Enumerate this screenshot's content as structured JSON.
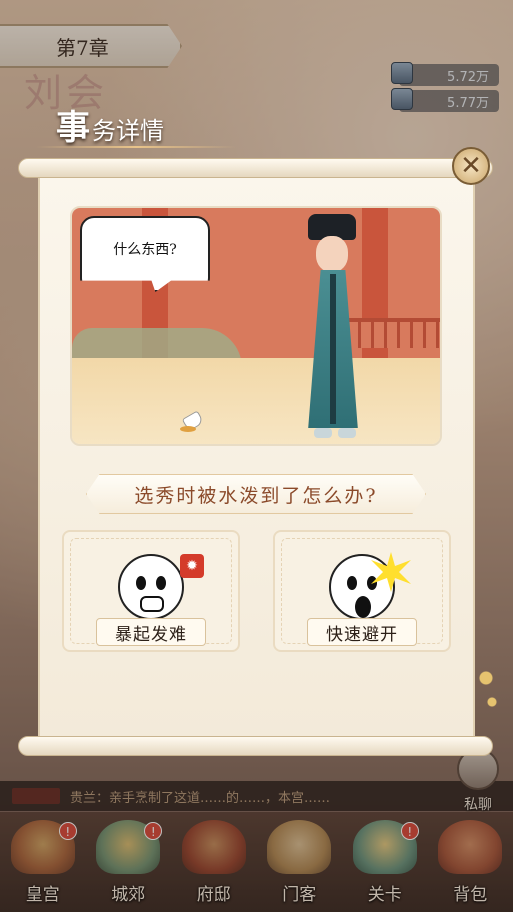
{
  "header": {
    "chapter": "第7章",
    "resources": [
      {
        "icon": "silver-ingot-icon",
        "value": "5.72万"
      },
      {
        "icon": "silk-bundle-icon",
        "value": "5.77万"
      }
    ],
    "background_text": "刘会"
  },
  "modal": {
    "title_big": "事",
    "title_rest": "务详情",
    "close_icon": "close-icon",
    "scene": {
      "speech": "什么东西?"
    },
    "question": "选秀时被水泼到了怎么办?",
    "options": [
      {
        "label": "暴起发难",
        "emoji": "angry-face-icon"
      },
      {
        "label": "快速避开",
        "emoji": "shocked-face-icon"
      }
    ]
  },
  "chat": {
    "message": "贵兰：亲手烹制了这道……的……，本宫……",
    "private_chat_label": "私聊"
  },
  "nav": {
    "items": [
      {
        "label": "皇宫",
        "badge": "!"
      },
      {
        "label": "城郊",
        "badge": "!"
      },
      {
        "label": "府邸",
        "badge": ""
      },
      {
        "label": "门客",
        "badge": ""
      },
      {
        "label": "关卡",
        "badge": "!"
      },
      {
        "label": "背包",
        "badge": ""
      }
    ]
  },
  "colors": {
    "accent": "#8b4a2a",
    "badge": "#d9483a",
    "paper": "#fbf6ec"
  }
}
